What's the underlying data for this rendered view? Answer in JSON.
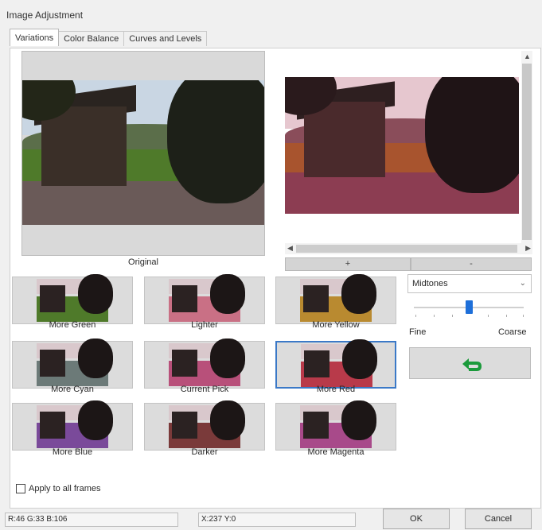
{
  "window": {
    "title": "Image Adjustment"
  },
  "tabs": [
    {
      "label": "Variations"
    },
    {
      "label": "Color Balance"
    },
    {
      "label": "Curves and Levels"
    }
  ],
  "original": {
    "label": "Original"
  },
  "zoom": {
    "in_label": "+",
    "out_label": "-"
  },
  "variations": [
    {
      "label": "More Green",
      "tint": "#4f7a2a"
    },
    {
      "label": "Lighter",
      "tint": "#c97085"
    },
    {
      "label": "More Yellow",
      "tint": "#b98a30"
    },
    {
      "label": "More Cyan",
      "tint": "#6c7a78"
    },
    {
      "label": "Current Pick",
      "tint": "#b8507a"
    },
    {
      "label": "More Red",
      "tint": "#b83a4a"
    },
    {
      "label": "More Blue",
      "tint": "#7a4a9a"
    },
    {
      "label": "Darker",
      "tint": "#7a3a3a"
    },
    {
      "label": "More Magenta",
      "tint": "#a84a8a"
    }
  ],
  "selected_variation": "More Red",
  "range_select": {
    "value": "Midtones"
  },
  "slider": {
    "fine_label": "Fine",
    "coarse_label": "Coarse",
    "level": 0.5
  },
  "apply_all": {
    "label": "Apply to all frames",
    "checked": false
  },
  "status": {
    "rgb": "R:46 G:33 B:106",
    "xy": "X:237 Y:0"
  },
  "buttons": {
    "ok": "OK",
    "cancel": "Cancel"
  },
  "colors": {
    "accent": "#1e6fd9",
    "selection": "#3b79c7"
  }
}
